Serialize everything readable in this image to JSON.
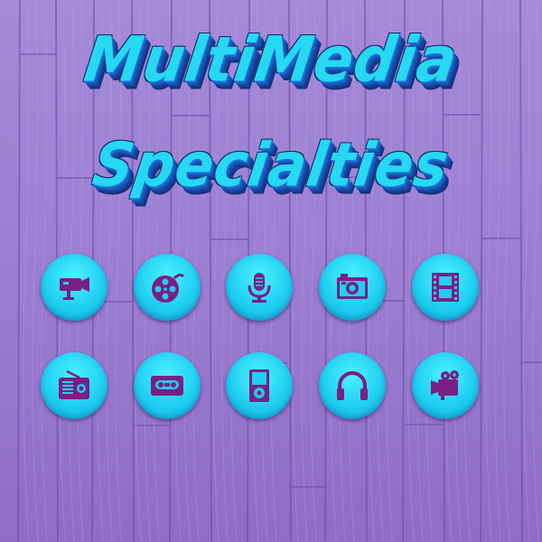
{
  "title": {
    "line1": "MultiMedia",
    "line2": "Specialties"
  },
  "colors": {
    "background": "#9d80d2",
    "title_fill": "#27d8f2",
    "title_extrude": "#1a4fb0",
    "icon_circle": "#1fcff0",
    "icon_glyph": "#7a1f85"
  },
  "icons": [
    {
      "name": "security-camera-icon"
    },
    {
      "name": "film-reel-icon"
    },
    {
      "name": "microphone-icon"
    },
    {
      "name": "photo-camera-icon"
    },
    {
      "name": "film-strip-icon"
    },
    {
      "name": "radio-icon"
    },
    {
      "name": "cassette-tape-icon"
    },
    {
      "name": "media-player-icon"
    },
    {
      "name": "headphones-icon"
    },
    {
      "name": "video-camera-icon"
    }
  ]
}
